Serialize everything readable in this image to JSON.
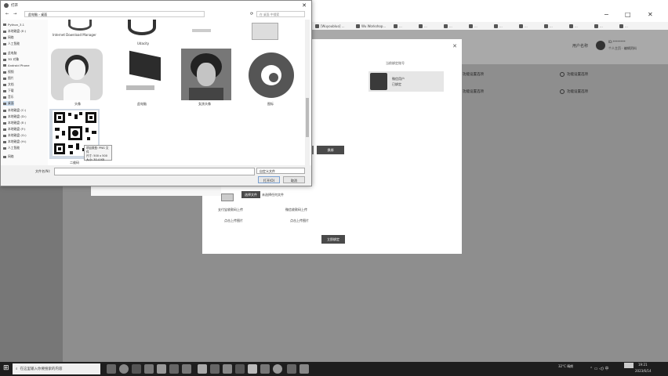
{
  "browser": {
    "window_controls": {
      "minimize": "−",
      "maximize": "□",
      "close": "✕"
    },
    "bookmarks": [
      "[Wuyoubluo] ...",
      "Wu Workshop...",
      "...",
      "...",
      "...",
      "...",
      "...",
      "...",
      "...",
      "...",
      "...",
      "..."
    ]
  },
  "app": {
    "user_name": "用户名称",
    "user_meta_1": "ID:********",
    "user_meta_2": "个人主页 · 编辑资料",
    "features": [
      {
        "label": "功能设置选项",
        "icon": "dot-icon"
      },
      {
        "label": "功能设置选项",
        "icon": "refresh-icon"
      },
      {
        "label": "功能设置选项",
        "icon": "dot-icon"
      },
      {
        "label": "功能设置选项",
        "icon": "gear-icon"
      }
    ]
  },
  "modal": {
    "close": "✕",
    "section_title": "当前绑定账号",
    "account_name": "微信用户",
    "account_sub": "已绑定",
    "side_button": "换绑",
    "upload_button": "选择文件",
    "upload_hint": "未选择任何文件",
    "label_left": "支付宝收款码上传",
    "label_right": "微信收款码上传",
    "sub_left": "点击上传图片",
    "sub_right": "点击上传图片",
    "confirm": "立即绑定"
  },
  "file_dialog": {
    "title": "打开",
    "address": "此电脑 › 桌面",
    "search_placeholder": "在 桌面 中搜索",
    "nav_items": [
      "Python_3.1",
      "本地磁盘 (E:)",
      "网络",
      "人工智能",
      "此电脑",
      "3D 对象",
      "Android Phone",
      "视频",
      "图片",
      "文档",
      "下载",
      "音乐",
      "桌面",
      "本地磁盘 (C:)",
      "本地磁盘 (D:)",
      "本地磁盘 (E:)",
      "本地磁盘 (F:)",
      "本地磁盘 (G:)",
      "本地磁盘 (H:)",
      "人工智能",
      "网络"
    ],
    "top_row_labels": [
      "Internet Download Manager",
      "Udacity",
      "",
      ""
    ],
    "files": [
      "头像",
      "此电脑",
      "女孩头像",
      "图标"
    ],
    "qr_label": "二维码",
    "tooltip_lines": [
      "项目类型: PNG 文件",
      "尺寸: 500 x 500",
      "大小: 30.4 KB"
    ],
    "filename_label": "文件名(N):",
    "filter_value": "自定义文件",
    "open_button": "打开(O)",
    "cancel_button": "取消"
  },
  "taskbar": {
    "search_placeholder": "在这里输入你要搜索的内容",
    "weather": "32°C 晴朗",
    "time": "19:21",
    "date": "2023/6/14"
  }
}
